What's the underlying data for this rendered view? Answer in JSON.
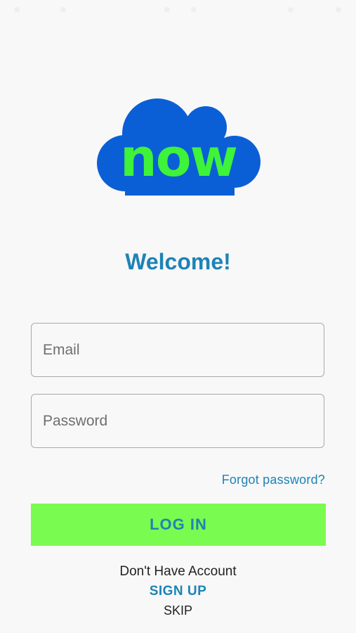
{
  "logo": {
    "text": "now",
    "cloud_color": "#0a5fd6",
    "text_color": "#3ff23a"
  },
  "welcome_title": "Welcome!",
  "form": {
    "email_placeholder": "Email",
    "password_placeholder": "Password",
    "forgot_password": "Forgot password?",
    "login_label": "LOG IN"
  },
  "footer": {
    "no_account_text": "Don't Have Account",
    "signup_label": "SIGN UP",
    "skip_label": "SKIP"
  },
  "colors": {
    "accent": "#1d83b6",
    "login_button_bg": "#7afb4f",
    "background": "#f8f8f8"
  }
}
